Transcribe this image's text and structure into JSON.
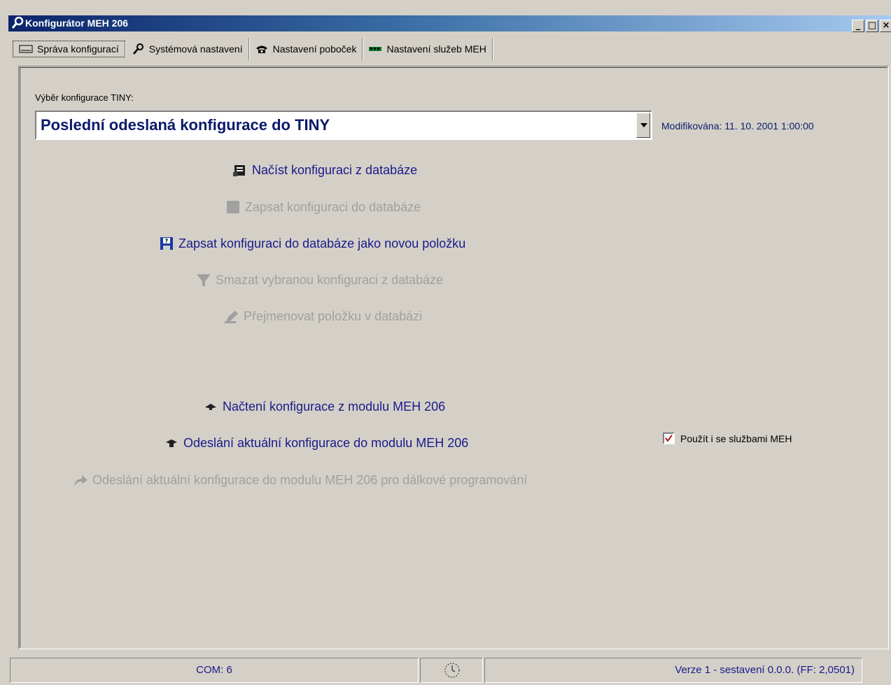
{
  "window": {
    "title": "Konfigurátor MEH 206",
    "minimize": "_",
    "maximize": "□",
    "close": "×"
  },
  "tabs": [
    {
      "label": "Správa konfigurací",
      "icon": "keyboard-icon"
    },
    {
      "label": "Systémová nastavení",
      "icon": "wrench-icon"
    },
    {
      "label": "Nastavení poboček",
      "icon": "telephone-icon"
    },
    {
      "label": "Nastavení služeb MEH",
      "icon": "circuit-board-icon"
    }
  ],
  "config": {
    "label": "Výběr konfigurace TINY:",
    "selected": "Poslední odeslaná konfigurace do TINY",
    "modified": "Modifikována: 11. 10. 2001 1:00:00"
  },
  "actions": {
    "load_db": "Načíst konfiguraci z databáze",
    "save_db": "Zapsat konfiguraci do databáze",
    "save_db_new": "Zapsat konfiguraci do databáze jako novou položku",
    "delete_db": "Smazat vybranou konfiguraci z databáze",
    "rename_db": "Přejmenovat položku v databázi",
    "load_module": "Načtení konfigurace z modulu MEH 206",
    "send_module": "Odeslání aktuální konfigurace do modulu MEH 206",
    "send_remote": "Odeslání aktuální konfigurace do modulu MEH 206 pro dálkové programování"
  },
  "use_services": {
    "label": "Použít i se službami MEH",
    "checked": true
  },
  "status": {
    "port": "COM: 6",
    "version": "Verze 1 - sestavení 0.0.0. (FF: 2,0501)"
  },
  "colors": {
    "link": "#1a1a8a",
    "disabled": "#a0a0a0",
    "title_start": "#0a246a",
    "title_end": "#a6caf0"
  }
}
